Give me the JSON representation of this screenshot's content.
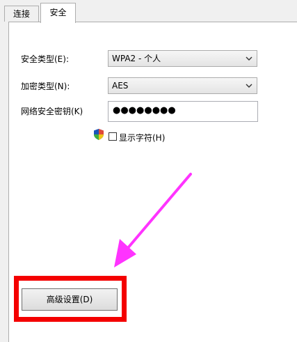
{
  "tabs": [
    {
      "label": "连接"
    },
    {
      "label": "安全"
    }
  ],
  "security_type": {
    "label": "安全类型(E):",
    "value": "WPA2 - 个人"
  },
  "encryption_type": {
    "label": "加密类型(N):",
    "value": "AES"
  },
  "network_key": {
    "label": "网络安全密钥(K)",
    "value": "●●●●●●●●"
  },
  "show_characters": {
    "label": "显示字符(H)",
    "checked": false
  },
  "advanced_button": {
    "label": "高级设置(D)"
  },
  "colors": {
    "highlight": "#f40000",
    "arrow": "#ff33ff"
  }
}
